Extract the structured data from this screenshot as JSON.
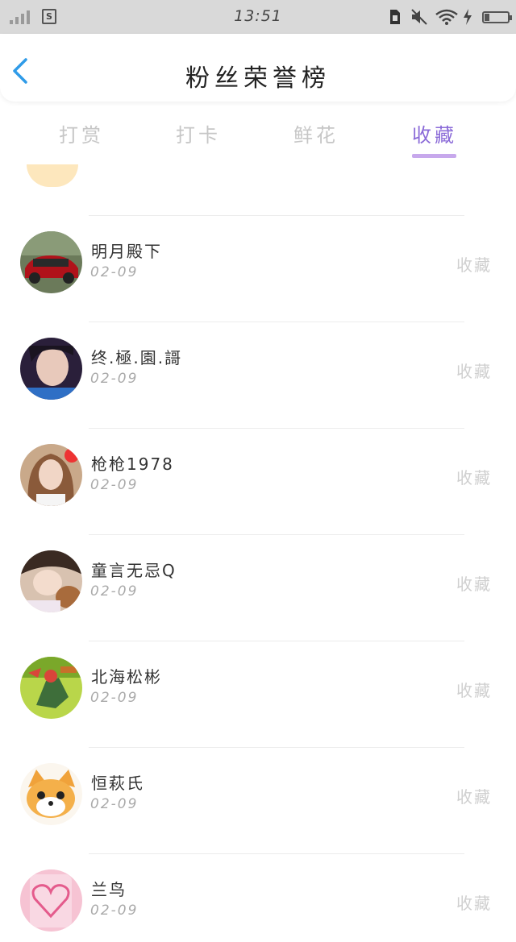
{
  "status_bar": {
    "time": "13:51",
    "sim_badge": "S"
  },
  "header": {
    "title": "粉丝荣誉榜"
  },
  "tabs": [
    {
      "label": "打赏",
      "active": false
    },
    {
      "label": "打卡",
      "active": false
    },
    {
      "label": "鲜花",
      "active": false
    },
    {
      "label": "收藏",
      "active": true
    }
  ],
  "fans": [
    {
      "name": "明月殿下",
      "date": "02-09",
      "action": "收藏",
      "avatar": "car-avatar"
    },
    {
      "name": "终.極.園.謌",
      "date": "02-09",
      "action": "收藏",
      "avatar": "girl-avatar"
    },
    {
      "name": "枪枪1978",
      "date": "02-09",
      "action": "收藏",
      "avatar": "woman-avatar"
    },
    {
      "name": "童言无忌Q",
      "date": "02-09",
      "action": "收藏",
      "avatar": "child-avatar"
    },
    {
      "name": "北海松彬",
      "date": "02-09",
      "action": "收藏",
      "avatar": "cartoon-avatar"
    },
    {
      "name": "恒萩氏",
      "date": "02-09",
      "action": "收藏",
      "avatar": "dog-avatar"
    },
    {
      "name": "兰鸟",
      "date": "02-09",
      "action": "收藏",
      "avatar": "heart-avatar"
    }
  ],
  "colors": {
    "accent": "#8b6bd8",
    "tab_underline": "#c7a8ec",
    "back_arrow": "#2f9be8"
  }
}
